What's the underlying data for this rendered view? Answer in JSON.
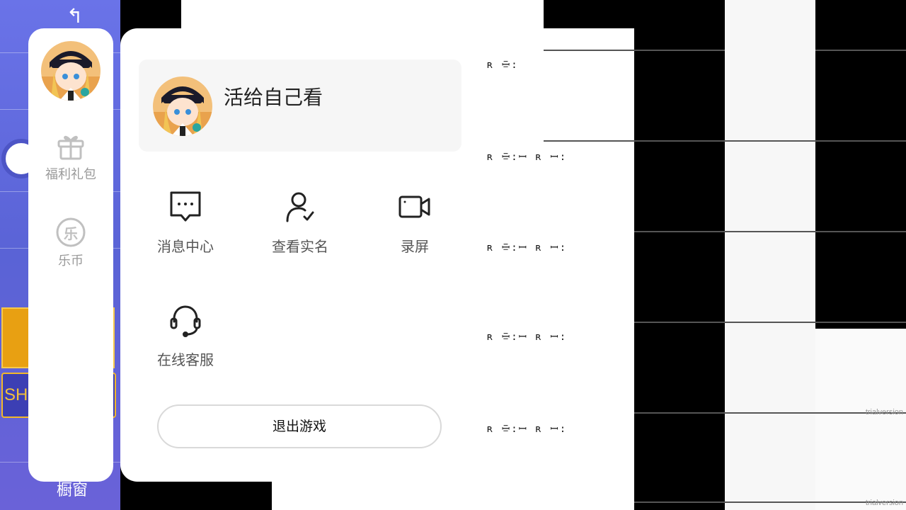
{
  "background": {
    "shop_label": "SHO",
    "window_label": "橱窗",
    "watermark": "trialversion"
  },
  "sidebar": {
    "items": [
      {
        "label": "福利礼包",
        "icon": "gift-icon"
      },
      {
        "label": "乐币",
        "icon": "le-coin-icon",
        "glyph": "乐"
      }
    ]
  },
  "profile": {
    "nickname": "活给自己看"
  },
  "menu": {
    "items": [
      {
        "label": "消息中心",
        "icon": "message-icon"
      },
      {
        "label": "查看实名",
        "icon": "user-verify-icon"
      },
      {
        "label": "录屏",
        "icon": "video-record-icon"
      },
      {
        "label": "在线客服",
        "icon": "headset-icon"
      }
    ]
  },
  "exit_button": {
    "label": "退出游戏"
  },
  "colors": {
    "panel_bg": "#ffffff",
    "profile_bg": "#f6f6f6",
    "sidebar_text": "#9a9a9a",
    "game_purple": "#6a73e8",
    "game_orange": "#e8a012"
  }
}
